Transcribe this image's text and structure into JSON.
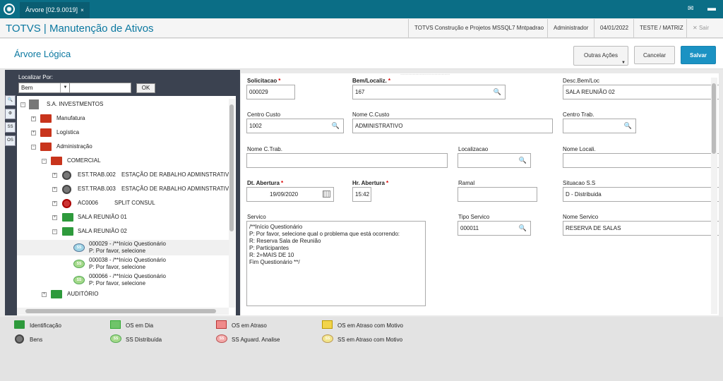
{
  "tabbar": {
    "tab_label": "Árvore [02.9.0019]",
    "tab_close": "×"
  },
  "header": {
    "title": "TOTVS | Manutenção de Ativos",
    "company": "TOTVS Construção e Projetos MSSQL7 Mntpadrao",
    "user": "Administrador",
    "date": "04/01/2022",
    "branch": "TESTE / MATRIZ",
    "exit": "Sair"
  },
  "toolbar": {
    "title": "Árvore Lógica",
    "other_actions": "Outras Ações",
    "cancel": "Cancelar",
    "save": "Salvar"
  },
  "search": {
    "label": "Localizar Por:",
    "select_value": "Bem",
    "ok": "OK"
  },
  "tree": [
    {
      "code": "S.A. INVESTMENTOS",
      "desc": ""
    },
    {
      "code": "Manufatura",
      "desc": ""
    },
    {
      "code": "Logística",
      "desc": ""
    },
    {
      "code": "Administração",
      "desc": ""
    },
    {
      "code": "COMERCIAL",
      "desc": ""
    },
    {
      "code": "EST.TRAB.002",
      "desc": "ESTAÇÃO DE RABALHO ADMINSTRATIVC"
    },
    {
      "code": "EST.TRAB.003",
      "desc": "ESTAÇÃO DE RABALHO ADMINSTRATIVC"
    },
    {
      "code": "AC0006",
      "desc": "SPLIT CONSUL"
    },
    {
      "code": "SALA REUNIÃO 01",
      "desc": ""
    },
    {
      "code": "SALA REUNIÃO 02",
      "desc": ""
    },
    {
      "code": "000029 - /**Início Questionário",
      "desc": "P: Por favor, selecione"
    },
    {
      "code": "000038 - /**Início Questionário",
      "desc": "P: Por favor, selecione"
    },
    {
      "code": "000066 - /**Início Questionário",
      "desc": "P: Por favor, selecione"
    },
    {
      "code": "AUDITÓRIO",
      "desc": ""
    }
  ],
  "form": {
    "solicitacao": {
      "label": "Solicitacao",
      "value": "000029"
    },
    "bem": {
      "label": "Bem/Localiz.",
      "value": "167"
    },
    "desc_bem": {
      "label": "Desc.Bem/Loc",
      "value": "SALA REUNIÃO 02"
    },
    "centro_custo": {
      "label": "Centro Custo",
      "value": "1002"
    },
    "nome_ccusto": {
      "label": "Nome C.Custo",
      "value": "ADMINISTRATIVO"
    },
    "centro_trab": {
      "label": "Centro Trab.",
      "value": ""
    },
    "nome_ctrab": {
      "label": "Nome C.Trab.",
      "value": ""
    },
    "localizacao": {
      "label": "Localizacao",
      "value": ""
    },
    "nome_local": {
      "label": "Nome Locali.",
      "value": ""
    },
    "dt_abertura": {
      "label": "Dt. Abertura",
      "value": "19/09/2020"
    },
    "hr_abertura": {
      "label": "Hr. Abertura",
      "value": "15:42"
    },
    "ramal": {
      "label": "Ramal",
      "value": ""
    },
    "situacao": {
      "label": "Situacao S.S",
      "value": "D - Distribuida"
    },
    "servico": {
      "label": "Servico",
      "value": "/**Início Questionário\nP: Por favor, selecione qual o problema que está ocorrendo:\nR: Reserva Sala de Reunião\nP: Participantes\nR: 2=MAIS DE 10\nFim Questionário **/"
    },
    "tipo_servico": {
      "label": "Tipo Servico",
      "value": "000011"
    },
    "nome_servico": {
      "label": "Nome Servico",
      "value": "RESERVA DE SALAS"
    }
  },
  "legend": {
    "identificacao": "Identificação",
    "bens": "Bens",
    "os_em_dia": "OS em Dia",
    "ss_distribuida": "SS Distribuída",
    "os_em_atraso": "OS em Atraso",
    "ss_aguard": "SS Aguard. Analise",
    "os_atraso_motivo": "OS em Atraso com Motivo",
    "ss_atraso_motivo": "SS em Atraso com Motivo"
  },
  "icon_labels": {
    "ss": "SS"
  },
  "colors": {
    "accent": "#0b6e86",
    "primary_button": "#1b92c3",
    "required": "#dd0000"
  }
}
